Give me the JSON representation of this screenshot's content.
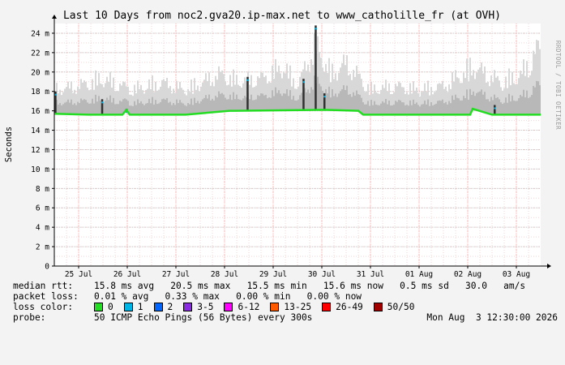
{
  "chart_data": {
    "type": "area",
    "title": "Last 10 Days from noc2.gva20.ip-max.net to www_catholille_fr (at OVH)",
    "ylabel": "Seconds",
    "side_label": "RRDTOOL / TOBI OETIKER",
    "ylim": [
      0,
      25
    ],
    "yticks": [
      {
        "v": 0,
        "label": "0"
      },
      {
        "v": 2,
        "label": "2 m"
      },
      {
        "v": 4,
        "label": "4 m"
      },
      {
        "v": 6,
        "label": "6 m"
      },
      {
        "v": 8,
        "label": "8 m"
      },
      {
        "v": 10,
        "label": "10 m"
      },
      {
        "v": 12,
        "label": "12 m"
      },
      {
        "v": 14,
        "label": "14 m"
      },
      {
        "v": 16,
        "label": "16 m"
      },
      {
        "v": 18,
        "label": "18 m"
      },
      {
        "v": 20,
        "label": "20 m"
      },
      {
        "v": 22,
        "label": "22 m"
      },
      {
        "v": 24,
        "label": "24 m"
      }
    ],
    "xlim": [
      0,
      10
    ],
    "xticks": [
      {
        "v": 0.5,
        "label": "25 Jul"
      },
      {
        "v": 1.5,
        "label": "26 Jul"
      },
      {
        "v": 2.5,
        "label": "27 Jul"
      },
      {
        "v": 3.5,
        "label": "28 Jul"
      },
      {
        "v": 4.5,
        "label": "29 Jul"
      },
      {
        "v": 5.5,
        "label": "30 Jul"
      },
      {
        "v": 6.5,
        "label": "31 Jul"
      },
      {
        "v": 7.5,
        "label": "01 Aug"
      },
      {
        "v": 8.5,
        "label": "02 Aug"
      },
      {
        "v": 9.5,
        "label": "03 Aug"
      }
    ],
    "series": [
      {
        "name": "median rtt",
        "color": "#22dd22",
        "x": [
          0,
          0.7,
          1.0,
          1.4,
          1.48,
          1.55,
          2.7,
          3.6,
          3.7,
          5.55,
          6.25,
          6.35,
          7.0,
          8.0,
          8.3,
          8.55,
          8.6,
          9.0,
          9.5,
          10
        ],
        "y": [
          15.7,
          15.6,
          15.6,
          15.6,
          16.1,
          15.6,
          15.6,
          16.0,
          16.0,
          16.1,
          16.0,
          15.6,
          15.6,
          15.6,
          15.6,
          15.6,
          16.2,
          15.6,
          15.6,
          15.6
        ]
      }
    ],
    "spread_max": [
      {
        "x": 0.05,
        "y": 19.0
      },
      {
        "x": 0.5,
        "y": 19.5
      },
      {
        "x": 1.0,
        "y": 20.5
      },
      {
        "x": 1.6,
        "y": 19.0
      },
      {
        "x": 2.2,
        "y": 20.0
      },
      {
        "x": 2.7,
        "y": 19.0
      },
      {
        "x": 3.4,
        "y": 21.0
      },
      {
        "x": 3.8,
        "y": 20.0
      },
      {
        "x": 4.3,
        "y": 20.5
      },
      {
        "x": 4.7,
        "y": 22.0
      },
      {
        "x": 5.0,
        "y": 19.5
      },
      {
        "x": 5.37,
        "y": 24.8
      },
      {
        "x": 5.7,
        "y": 21.0
      },
      {
        "x": 6.0,
        "y": 22.5
      },
      {
        "x": 6.5,
        "y": 19.0
      },
      {
        "x": 7.0,
        "y": 19.5
      },
      {
        "x": 7.5,
        "y": 19.0
      },
      {
        "x": 8.0,
        "y": 19.5
      },
      {
        "x": 8.6,
        "y": 22.0
      },
      {
        "x": 9.2,
        "y": 20.0
      },
      {
        "x": 9.6,
        "y": 21.0
      },
      {
        "x": 9.95,
        "y": 24.5
      }
    ],
    "spikes": [
      {
        "x": 0.02,
        "y": 18.0
      },
      {
        "x": 0.98,
        "y": 17.2
      },
      {
        "x": 1.48,
        "y": 16.2
      },
      {
        "x": 3.97,
        "y": 19.5
      },
      {
        "x": 5.12,
        "y": 19.3
      },
      {
        "x": 5.37,
        "y": 24.8
      },
      {
        "x": 5.55,
        "y": 17.8
      },
      {
        "x": 9.05,
        "y": 16.6
      }
    ]
  },
  "legend": {
    "median_rtt": {
      "label": "median rtt:",
      "value": "15.8 ms avg   20.5 ms max   15.5 ms min   15.6 ms now   0.5 ms sd   30.0   am/s"
    },
    "packet_loss": {
      "label": "packet loss:",
      "value": "0.01 % avg   0.33 % max   0.00 % min   0.00 % now"
    },
    "loss_color": {
      "label": "loss color:",
      "items": [
        {
          "label": "0",
          "color": "#22dd22"
        },
        {
          "label": "1",
          "color": "#00b4e6"
        },
        {
          "label": "2",
          "color": "#0064ff"
        },
        {
          "label": "3-5",
          "color": "#8a2be2"
        },
        {
          "label": "6-12",
          "color": "#ff00ff"
        },
        {
          "label": "13-25",
          "color": "#ff5a00"
        },
        {
          "label": "26-49",
          "color": "#ff0000"
        },
        {
          "label": "50/50",
          "color": "#a00000"
        }
      ]
    },
    "probe": {
      "label": "probe:",
      "value": "50 ICMP Echo Pings (56 Bytes) every 300s"
    },
    "date": "Mon Aug  3 12:30:00 2026"
  },
  "colors": {
    "grid": "#ffaaaa",
    "background": "#f3f3f3",
    "plot": "#ffffff",
    "axis": "#000000"
  }
}
